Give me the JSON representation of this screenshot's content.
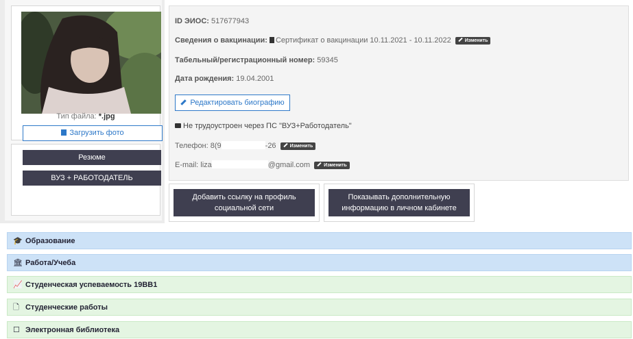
{
  "photo": {
    "file_type_label": "Тип файла:",
    "file_type_value": "*.jpg",
    "upload_label": "Загрузить фото"
  },
  "left_buttons": {
    "resume": "Резюме",
    "vuz_employer": "ВУЗ + РАБОТОДАТЕЛЬ"
  },
  "profile": {
    "eios_id_label": "ID ЭИОС:",
    "eios_id_value": "517677943",
    "vaccination_label": "Сведения о вакцинации:",
    "vaccination_value": "Сертификат о вакцинации 10.11.2021 - 10.11.2022",
    "edit_label": "Изменить",
    "tab_number_label": "Табельный/регистрационный номер:",
    "tab_number_value": "59345",
    "birth_label": "Дата рождения:",
    "birth_value": "19.04.2001",
    "edit_bio_button": "Редактировать биографию",
    "employment_text": "Не трудоустроен через ПС \"ВУЗ+Работодатель\"",
    "phone_prefix": "Телефон: 8(9",
    "phone_suffix": "-26",
    "email_prefix": "E-mail: liza",
    "email_suffix": "@gmail.com"
  },
  "actions": {
    "add_social_link": "Добавить ссылку на профиль социальной сети",
    "show_extra_info": "Показывать дополнительную информацию в личном кабинете"
  },
  "accordion": [
    {
      "label": "Образование",
      "icon": "graduation-cap-icon",
      "color": "#cde2f7"
    },
    {
      "label": "Работа/Учеба",
      "icon": "institution-icon",
      "color": "#cde2f7"
    },
    {
      "label": "Студенческая успеваемость 19ВВ1",
      "icon": "chart-icon",
      "color": "#e4f5e2"
    },
    {
      "label": "Студенческие работы",
      "icon": "file-icon",
      "color": "#e4f5e2"
    },
    {
      "label": "Электронная библиотека",
      "icon": "book-icon",
      "color": "#e4f5e2"
    }
  ],
  "colors": {
    "accent_blue": "#2d78c8",
    "dark_button": "#3f3f50"
  }
}
